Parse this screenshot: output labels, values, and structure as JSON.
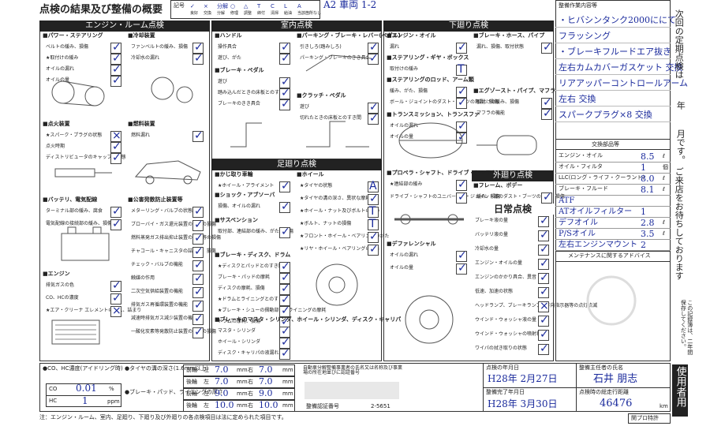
{
  "header": {
    "title": "点検の結果及び整備の概要",
    "legend_label": "記号",
    "legend": [
      {
        "sym": "✓",
        "label": "良好"
      },
      {
        "sym": "×",
        "label": "交換"
      },
      {
        "sym": "分解",
        "label": "分解"
      },
      {
        "sym": "○",
        "label": "修理"
      },
      {
        "sym": "△",
        "label": "調整"
      },
      {
        "sym": "T",
        "label": "締付"
      },
      {
        "sym": "C",
        "label": "清掃"
      },
      {
        "sym": "L",
        "label": "給油"
      },
      {
        "sym": "A",
        "label": "当該箇所なし"
      },
      {
        "sym": "/",
        "label": ""
      }
    ],
    "handwritten_top": "A2 車両  1-2"
  },
  "engine": {
    "title": "エンジン・ルーム点検",
    "power_steering": {
      "title": "■パワー・ステアリング",
      "items": [
        "ベルトの緩み、損傷",
        "★取付けの緩み",
        "オイルの漏れ",
        "オイルの量"
      ],
      "marks": [
        "✓",
        "✓",
        "✓",
        "✓"
      ]
    },
    "cooling": {
      "title": "■冷却装置",
      "items": [
        "ファンベルトの緩み、損傷",
        "冷却水の漏れ"
      ],
      "marks": [
        "✓",
        "✓"
      ]
    },
    "ignition": {
      "title": "■点火装置",
      "items": [
        "★スパーク・プラグの状態",
        "点火時期",
        "ディストリビュータのキャップの状態"
      ],
      "marks": [
        "×",
        "✓",
        "✓"
      ]
    },
    "fuel": {
      "title": "■燃料装置",
      "items": [
        "燃料漏れ"
      ],
      "marks": [
        "✓"
      ]
    },
    "battery": {
      "title": "■バッテリ、電気配線",
      "items": [
        "ターミナル部の緩み、腐食",
        "電気配線の接続部の緩み、損傷"
      ],
      "marks": [
        "✓",
        "✓"
      ]
    },
    "emission": {
      "title": "■公害発散防止装置等",
      "items": [
        "メターリング・バルブの状態",
        "ブローバイ・ガス還元装置の配管の損傷",
        "燃料蒸発ガス排出抑止装置の配管等の損傷",
        "チャコール・キャニスタの詰まり、損傷",
        "チェック・バルブの機能",
        "触媒の作用",
        "二次空気供給装置の機能",
        "排気ガス再循環装置の機能",
        "減速時排気ガス減少装置の機能",
        "一酸化炭素等発散防止装置の配管の損傷"
      ],
      "marks": [
        "✓",
        "✓",
        "✓",
        "✓",
        "✓",
        "✓",
        "✓",
        "✓",
        "✓",
        "✓"
      ]
    },
    "engine": {
      "title": "■エンジン",
      "items": [
        "排気ガスの色",
        "CO、HCの濃度",
        "★エア・クリーナ エレメントの汚れ、詰まり"
      ],
      "marks": [
        "✓",
        "✓",
        "×"
      ]
    }
  },
  "cabin": {
    "title": "室内点検",
    "handle": {
      "title": "■ハンドル",
      "items": [
        "操作具合",
        "遊び、がた"
      ],
      "marks": [
        "✓",
        "✓"
      ]
    },
    "parking": {
      "title": "■パーキング・ブレーキ・レバー(ペダル)",
      "items": [
        "引きしろ(踏みしろ)",
        "パーキング・ブレーキのきき具合"
      ],
      "marks": [
        "✓",
        "✓"
      ]
    },
    "brake_pedal": {
      "title": "■ブレーキ・ペダル",
      "items": [
        "遊び",
        "踏み込んだときの床板とのすき間",
        "ブレーキのきき具合"
      ],
      "marks": [
        "✓",
        "✓",
        "✓"
      ]
    },
    "clutch": {
      "title": "■クラッチ・ペダル",
      "items": [
        "遊び",
        "切れたときの床板とのすき間"
      ],
      "marks": [
        "✓",
        "✓"
      ]
    }
  },
  "chassis": {
    "title": "足廻り点検",
    "tire_wheel": {
      "title": "■かじ取り車輪",
      "items": [
        "★ホイール・アライメント"
      ],
      "marks": [
        "✓"
      ]
    },
    "shock": {
      "title": "■ショック・アブソーバ",
      "items": [
        "損傷、オイルの漏れ"
      ],
      "marks": [
        "✓"
      ]
    },
    "suspension": {
      "title": "■サスペンション",
      "items": [
        "取付部、連結部の緩み、がた、損傷"
      ],
      "marks": [
        "✓"
      ]
    },
    "wheel": {
      "title": "■ホイール",
      "items": [
        "★タイヤの状態",
        "★タイヤの溝の深さ、異状な摩耗",
        "★ホイール・ナット及びボルトの緩み",
        "★ボルト、ナットの損傷",
        "★フロント・ホイール・ベアリングのがた",
        "★リヤ・ホイール・ベアリングのがた"
      ],
      "marks": [
        "A",
        "✓",
        "T",
        "T",
        "✓",
        "✓"
      ]
    },
    "brake_drum": {
      "title": "■ブレーキ・ディスク、ドラム",
      "items": [
        "★ディスクとパッドとのすき間",
        "ブレーキ・パッドの摩耗",
        "ディスクの摩耗、損傷",
        "★ドラムとライニングとのすき間",
        "★ブレーキ・シューの摺動部分、ライニングの摩耗",
        "ドラムの摩耗、損傷"
      ],
      "marks": [
        "✓",
        "✓",
        "✓",
        "✓",
        "✓",
        "✓"
      ]
    },
    "master_cyl": {
      "title": "■ブレーキのマスタ・シリンダ、ホイール・シリンダ、ディスク・キャリパ",
      "items": [
        "マスタ・シリンダ",
        "ホイール・シリンダ",
        "ディスク・キャリパの液漏れ"
      ],
      "marks": [
        "✓",
        "✓",
        "✓"
      ]
    }
  },
  "under": {
    "title": "下廻り点検",
    "engine_oil": {
      "title": "■エンジン・オイル",
      "items": [
        "漏れ"
      ],
      "marks": [
        "✓"
      ],
      "note": "(エンジン内部)"
    },
    "steering_gear": {
      "title": "■ステアリング・ギヤ・ボックス",
      "items": [
        "取付けの緩み"
      ],
      "marks": [
        "T"
      ]
    },
    "steering_rod": {
      "title": "■ステアリングのロッド、アーム類",
      "items": [
        "緩み、がた、損傷",
        "ボール・ジョイントのダスト・ブーツの亀裂、損傷"
      ],
      "marks": [
        "✓",
        "✓"
      ]
    },
    "transmission": {
      "title": "■トランスミッション、トランスファ",
      "items": [
        "オイルの漏れ",
        "オイルの量"
      ],
      "marks": [
        "✓",
        "✓"
      ]
    },
    "propeller": {
      "title": "■プロペラ・シャフト、ドライブ・シャフト",
      "items": [
        "★連結部の緩み",
        "ドライブ・シャフトのユニバーサル・ジョイント部のダスト・ブーツの亀裂、損傷"
      ],
      "marks": [
        "✓",
        "✓"
      ]
    },
    "differential": {
      "title": "■デファレンシャル",
      "items": [
        "オイルの漏れ",
        "オイルの量"
      ],
      "marks": [
        "✓",
        "✓"
      ]
    },
    "brake_hose": {
      "title": "■ブレーキ・ホース、パイプ",
      "items": [
        "漏れ、損傷、取付状態"
      ],
      "marks": [
        "✓"
      ]
    },
    "exhaust": {
      "title": "■エグゾースト・パイプ、マフラ",
      "items": [
        "取付けの緩み、損傷",
        "マフラの機能"
      ],
      "marks": [
        "✓",
        "✓"
      ]
    }
  },
  "exterior": {
    "title": "外廻り点検",
    "frame": {
      "title": "■フレーム、ボデー",
      "items": [
        "緩み、損傷"
      ],
      "marks": [
        "✓"
      ]
    }
  },
  "daily": {
    "title": "日常点検",
    "items": [
      "ブレーキ液の量",
      "バッテリ液の量",
      "冷却水の量",
      "エンジン・オイルの量",
      "エンジンのかかり具合、異音",
      "低速、加速の状態",
      "ヘッドランプ、ブレーキランプ、方向指示器等の点灯点滅",
      "ウインド・ウォッシャ液の量",
      "ウインド・ウォッシャの噴射状態",
      "ワイパの拭き取りの状態"
    ],
    "marks": [
      "✓",
      "✓",
      "✓",
      "✓",
      "✓",
      "✓",
      "×",
      "✓",
      "✓",
      "✓"
    ]
  },
  "right": {
    "next_check_label": "次回の定期点検は",
    "year_label": "年",
    "month_label": "月です。",
    "store_note": "ご来店をお待ちしております",
    "side_note": "この記録簿は、二年間保存してください。",
    "work_title": "整備作業内容等",
    "work_lines": [
      "・ヒバシンタンク2000ににて",
      "フラッシング",
      "・ブレーキフルードエア抜き",
      "左右カムカバーガスケット 交換",
      "リアアッパーコントロールアーム",
      "左右 交換",
      "スパークプラグ×8 交換"
    ],
    "parts_title": "交換部品等",
    "parts": [
      {
        "name": "エンジン・オイル",
        "qty": "8.5",
        "unit": "ℓ"
      },
      {
        "name": "オイル・フィルタ",
        "qty": "1",
        "unit": "個"
      },
      {
        "name": "LLC(ロング・ライフ・クーラント)",
        "qty": "8.0",
        "unit": "ℓ"
      },
      {
        "name": "ブレーキ・フルード",
        "qty": "8.1",
        "unit": "ℓ"
      },
      {
        "name": "ATF",
        "qty": "",
        "unit": ""
      },
      {
        "name": "ATオイルフィルター",
        "qty": "1",
        "unit": ""
      },
      {
        "name": "デフオイル",
        "qty": "2.8",
        "unit": "ℓ"
      },
      {
        "name": "P/Sオイル",
        "qty": "3.5",
        "unit": "ℓ"
      },
      {
        "name": "左右エンジンマウント",
        "qty": "2",
        "unit": ""
      }
    ],
    "advice_title": "メンテナンスに関するアドバイス",
    "stamp_label": "使用者用"
  },
  "bottom": {
    "co_hc_label": "●CO、HC濃度(アイドリング時)",
    "co_label": "CO",
    "co_val": "0.01",
    "co_unit": "%",
    "hc_label": "HC",
    "hc_val": "1",
    "hc_unit": "ppm",
    "tire_label": "●タイヤの溝の深さ(1.6mm以上)",
    "brake_label": "●ブレーキ・パッド、ライニングの厚さ",
    "front": "前輪",
    "rear": "後輪",
    "left": "左",
    "right": "右",
    "mm": "mm",
    "tire_front_left": "7.0",
    "tire_front_right": "7.0",
    "tire_rear_left": "7.0",
    "tire_rear_right": "7.0",
    "pad_front_left": "9.0",
    "pad_front_right": "9.0",
    "pad_rear_left": "10.0",
    "pad_rear_right": "10.0",
    "mechanic_label": "自動車分解整備事業者の氏名又は名称及び事業場の所在地並びに認証番号",
    "cert_label": "整備認証番号",
    "cert_no": "2-5651",
    "date_label": "点検の年月日",
    "date_val": "H28年 2月27日",
    "done_label": "整備完了年月日",
    "done_val": "H28年 3月30日",
    "chief_label": "整備主任者の氏名",
    "chief_val": "石井 朋志",
    "odometer_label": "点検時の総走行距離",
    "odometer_val": "46476",
    "odometer_unit": "km",
    "footnote": "注：エンジン・ルーム、室内、足廻り、下廻り及び外廻りの各点検項目は法に定められた項目です。",
    "corner": "関プロ特許"
  }
}
